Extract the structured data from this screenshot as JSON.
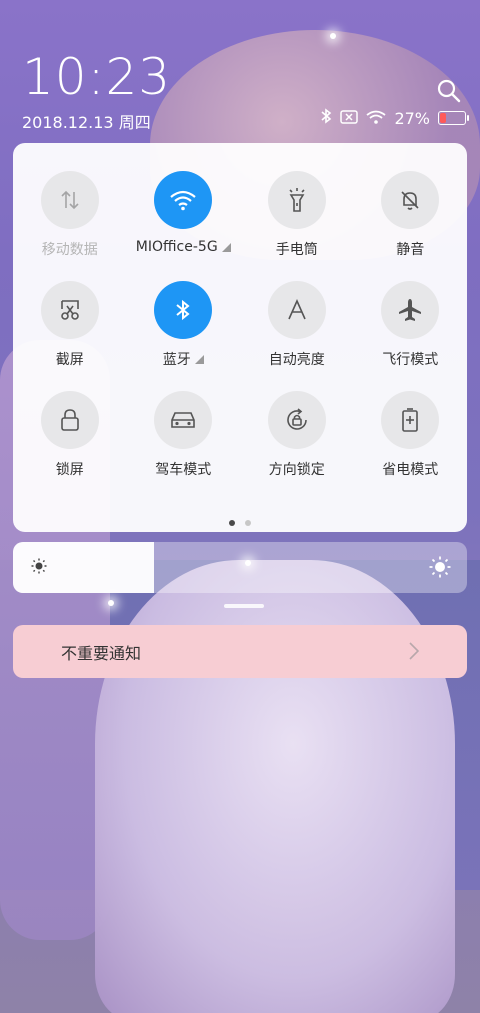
{
  "status": {
    "time": "10:23",
    "date": "2018.12.13 周四",
    "battery_percent": "27%",
    "battery_level": 0.27,
    "icons": [
      "bluetooth-icon",
      "no-sim-icon",
      "wifi-icon",
      "battery-icon"
    ]
  },
  "toggles": [
    {
      "label": "移动数据",
      "icon": "mobile-data-icon",
      "active": false,
      "disabled": true
    },
    {
      "label": "MIOffice-5G",
      "icon": "wifi-icon",
      "active": true,
      "expandable": true
    },
    {
      "label": "手电筒",
      "icon": "flashlight-icon",
      "active": false
    },
    {
      "label": "静音",
      "icon": "mute-bell-icon",
      "active": false
    },
    {
      "label": "截屏",
      "icon": "screenshot-icon",
      "active": false
    },
    {
      "label": "蓝牙",
      "icon": "bluetooth-icon",
      "active": true,
      "expandable": true
    },
    {
      "label": "自动亮度",
      "icon": "auto-brightness-icon",
      "active": false
    },
    {
      "label": "飞行模式",
      "icon": "airplane-icon",
      "active": false
    },
    {
      "label": "锁屏",
      "icon": "lock-icon",
      "active": false
    },
    {
      "label": "驾车模式",
      "icon": "car-icon",
      "active": false
    },
    {
      "label": "方向锁定",
      "icon": "rotation-lock-icon",
      "active": false
    },
    {
      "label": "省电模式",
      "icon": "battery-saver-icon",
      "active": false
    }
  ],
  "pager": {
    "pages": 2,
    "current": 1
  },
  "brightness": {
    "level": 0.31
  },
  "notification": {
    "title": "不重要通知"
  },
  "colors": {
    "accent": "#1e96f5",
    "notify_bg": "#f7cdd3",
    "battery_low": "#ff5a5a"
  }
}
